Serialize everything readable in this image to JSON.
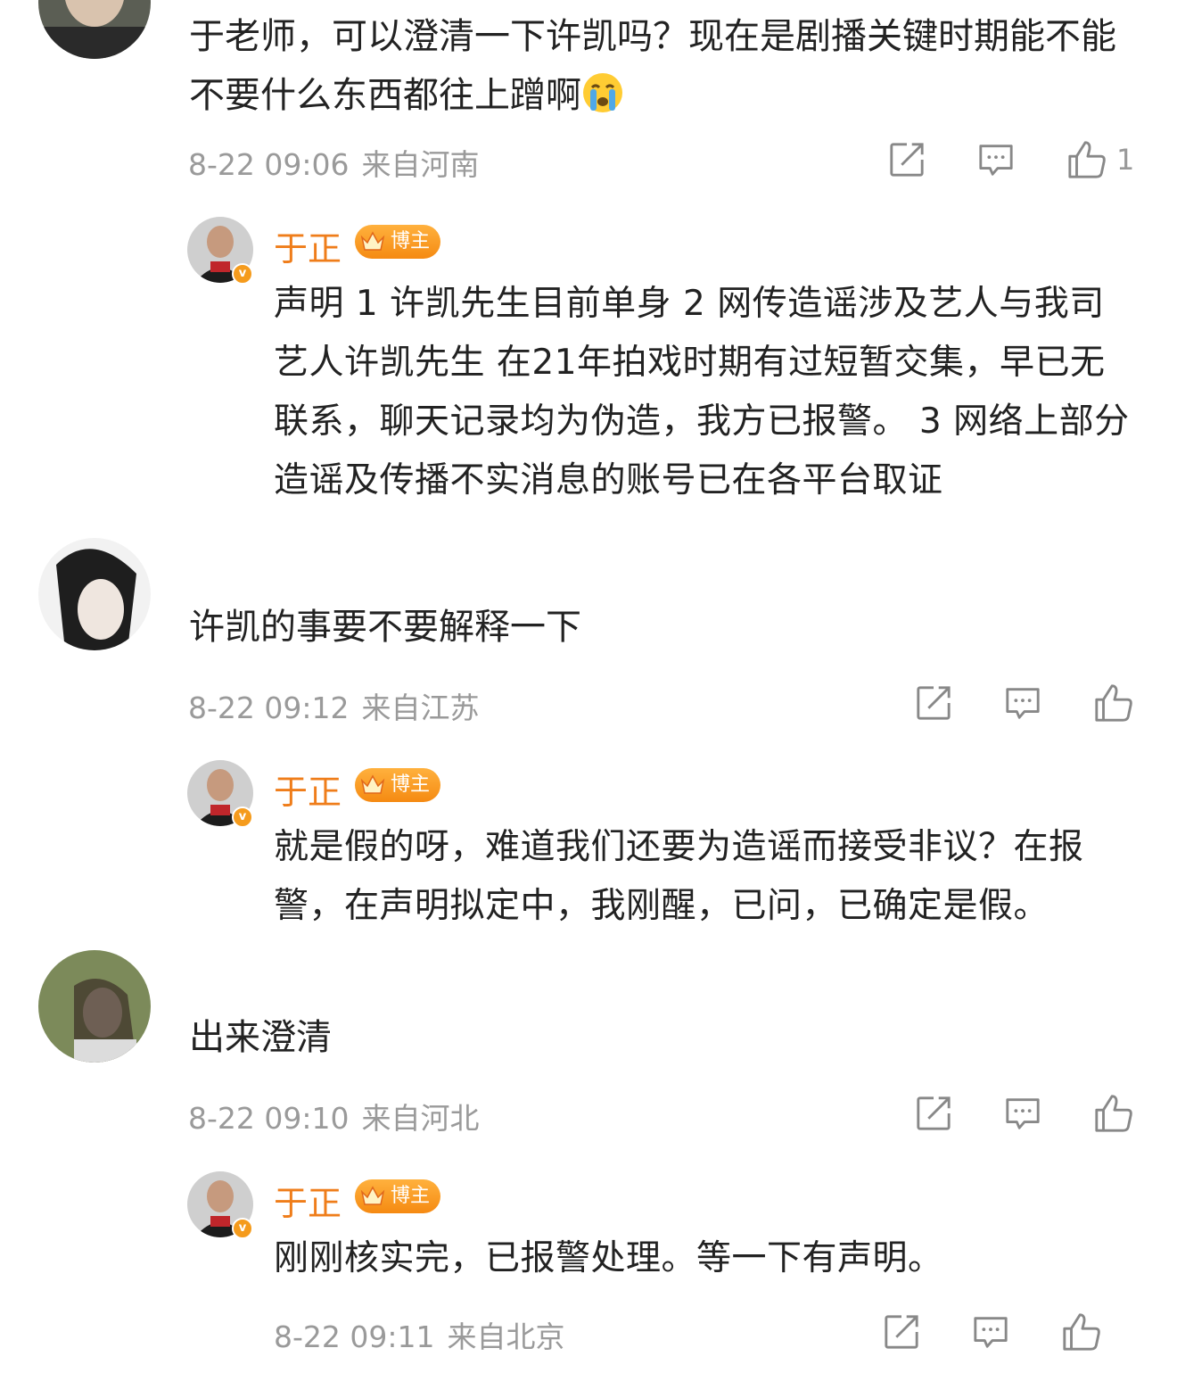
{
  "comments": [
    {
      "text": "于老师，可以澄清一下许凯吗？现在是剧播关键时期能不能不要什么东西都往上蹭啊",
      "emoji": "crying-face-emoji",
      "date": "8-22 09:06",
      "location": "来自河南",
      "like_count": "1",
      "reply": {
        "name": "于正",
        "badge": "博主",
        "text": "声明 1 许凯先生目前单身 2 网传造谣涉及艺人与我司艺人许凯先生 在21年拍戏时期有过短暂交集，早已无联系，聊天记录均为伪造，我方已报警。 3 网络上部分造谣及传播不实消息的账号已在各平台取证"
      }
    },
    {
      "text": "许凯的事要不要解释一下",
      "date": "8-22 09:12",
      "location": "来自江苏",
      "reply": {
        "name": "于正",
        "badge": "博主",
        "text": "就是假的呀，难道我们还要为造谣而接受非议？在报警，在声明拟定中，我刚醒，已问，已确定是假。"
      }
    },
    {
      "text": "出来澄清",
      "date": "8-22 09:10",
      "location": "来自河北",
      "reply": {
        "name": "于正",
        "badge": "博主",
        "text": "刚刚核实完，已报警处理。等一下有声明。",
        "date": "8-22 09:11",
        "location": "来自北京"
      }
    }
  ],
  "colors": {
    "accent": "#ef7d1a",
    "meta": "#9a9a9a",
    "text": "#222222",
    "icon": "#888888"
  }
}
